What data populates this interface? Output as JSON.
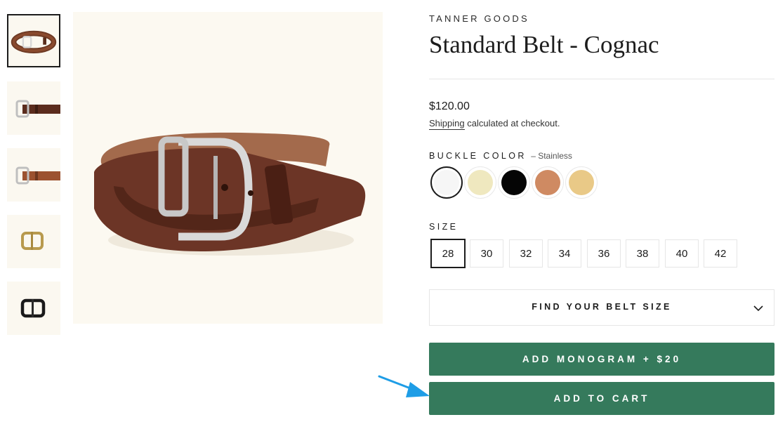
{
  "gallery": {
    "thumbnails": [
      {
        "icon": "belt-coiled-thumbnail",
        "selected": true
      },
      {
        "icon": "belt-buckle-dark-thumbnail",
        "selected": false
      },
      {
        "icon": "belt-buckle-light-thumbnail",
        "selected": false
      },
      {
        "icon": "brass-buckle-thumbnail",
        "selected": false
      },
      {
        "icon": "black-buckle-thumbnail",
        "selected": false
      }
    ],
    "main_image_icon": "cognac-belt-photo"
  },
  "product": {
    "vendor": "TANNER GOODS",
    "title": "Standard Belt - Cognac",
    "price": "$120.00",
    "shipping_link": "Shipping",
    "shipping_text": " calculated at checkout."
  },
  "buckle": {
    "label": "BUCKLE COLOR",
    "selected_text": "– Stainless",
    "swatches": [
      {
        "name": "stainless",
        "color": "#f6f6f6",
        "selected": true
      },
      {
        "name": "cream",
        "color": "#efe8bf",
        "selected": false
      },
      {
        "name": "black",
        "color": "#050505",
        "selected": false
      },
      {
        "name": "copper",
        "color": "#cf8a62",
        "selected": false
      },
      {
        "name": "brass",
        "color": "#e9c987",
        "selected": false
      }
    ]
  },
  "size": {
    "label": "SIZE",
    "options": [
      "28",
      "30",
      "32",
      "34",
      "36",
      "38",
      "40",
      "42"
    ],
    "selected": "28"
  },
  "belt_size_finder": {
    "label": "FIND YOUR BELT SIZE",
    "icon": "chevron-down-icon"
  },
  "buttons": {
    "monogram": "ADD MONOGRAM + $20",
    "cart": "ADD TO CART"
  },
  "colors": {
    "button_green": "#357a5c",
    "annotation_arrow": "#1e9de6"
  },
  "annotation": {
    "icon": "arrow-pointer-icon"
  }
}
